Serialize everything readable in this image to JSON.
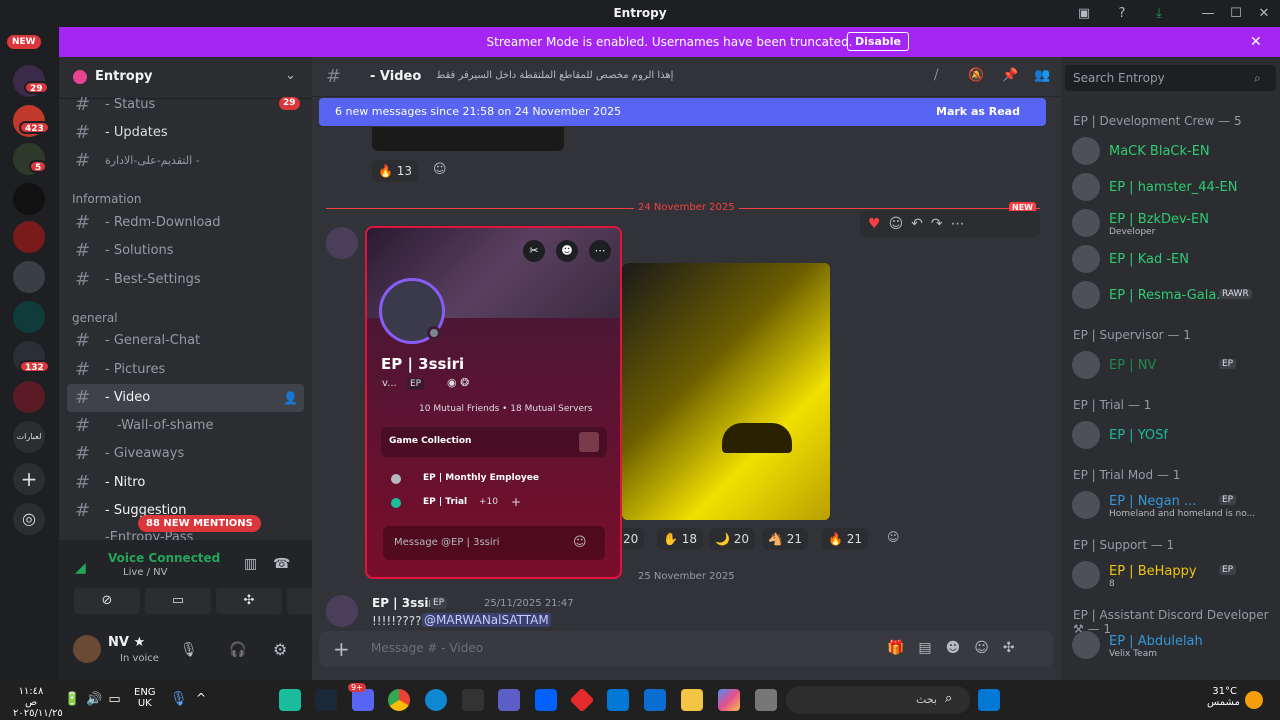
{
  "window": {
    "title": "Entropy"
  },
  "new_badge": "NEW",
  "banner": {
    "text": "Streamer Mode is enabled. Usernames have been truncated.",
    "button": "Disable"
  },
  "servers": [
    {
      "badge": "29"
    },
    {
      "badge": "423"
    },
    {
      "badge": "5"
    },
    {
      "badge": ""
    },
    {
      "badge": ""
    },
    {
      "badge": ""
    },
    {
      "badge": ""
    },
    {
      "badge": "132"
    },
    {
      "badge": ""
    },
    {
      "label": "لعبارات"
    }
  ],
  "guild": {
    "name": "Entropy"
  },
  "channels": {
    "top": [
      {
        "name": "- Status",
        "badge": "29"
      },
      {
        "name": "- Updates"
      },
      {
        "name": "التقديم-على-الادارة -"
      }
    ],
    "cat_info": "Information",
    "info": [
      {
        "name": "- Redm-Download"
      },
      {
        "name": "- Solutions"
      },
      {
        "name": "- Best-Settings"
      }
    ],
    "cat_general": "general",
    "general": [
      {
        "name": "- General-Chat"
      },
      {
        "name": "- Pictures"
      },
      {
        "name": "- Video"
      },
      {
        "name": "-Wall-of-shame"
      },
      {
        "name": "- Giveaways"
      },
      {
        "name": "- Nitro"
      },
      {
        "name": "- Suggestion"
      },
      {
        "name": "-Entropy-Pass"
      }
    ],
    "mentions": "88 NEW MENTIONS"
  },
  "voice": {
    "status": "Voice Connected",
    "channel": "Live / NV"
  },
  "user": {
    "name": "NV ★",
    "status": "In voice"
  },
  "header": {
    "channel": "- Video",
    "topic": "إهذا الروم مخصص للمقاطع الملتقطة داخل السيرفر فقط"
  },
  "newbar": {
    "text": "6 new messages since 21:58 on 24 November 2025",
    "mark": "Mark as Read"
  },
  "messages": {
    "top_reaction": "13",
    "divider1": "24 November 2025",
    "new_tag": "NEW",
    "reactions": [
      "20",
      "18",
      "20",
      "21",
      "21"
    ],
    "divider2": "25 November 2025",
    "msg2_author": "EP | 3ssiri",
    "msg2_tag": "EP",
    "msg2_time": "25/11/2025 21:47",
    "msg2_text": "!!!!!????",
    "msg2_mention": "@MARWANalSATTAM"
  },
  "input": {
    "placeholder": "Message # - Video"
  },
  "popout": {
    "name": "EP | 3ssiri",
    "tag_prefix": "v...",
    "tag": "EP",
    "mutuals": "10 Mutual Friends • 18 Mutual Servers",
    "game_collection": "Game Collection",
    "role1": "EP | Monthly Employee",
    "role2": "EP | Trial",
    "more": "+10",
    "message_placeholder": "Message @EP | 3ssiri"
  },
  "search": {
    "placeholder": "Search Entropy"
  },
  "members": {
    "groups": [
      {
        "title": "EP | Development Crew — 5",
        "items": [
          {
            "name": "MaCK BlaCk-EN",
            "color": "#2ecc71"
          },
          {
            "name": "EP | hamster_44-EN",
            "color": "#2ecc71"
          },
          {
            "name": "EP | BzkDev-EN",
            "color": "#2ecc71",
            "sub": "Developer"
          },
          {
            "name": "EP | Kad -EN",
            "color": "#2ecc71"
          },
          {
            "name": "EP | Resma-Gala...",
            "color": "#2ecc71",
            "extra": "RAWR"
          }
        ]
      },
      {
        "title": "EP | Supervisor — 1",
        "items": [
          {
            "name": "EP | NV",
            "color": "#1f8b4c",
            "extra": "EP"
          }
        ]
      },
      {
        "title": "EP | Trial — 1",
        "items": [
          {
            "name": "EP | YOSf",
            "color": "#1abc9c"
          }
        ]
      },
      {
        "title": "EP | Trial Mod — 1",
        "items": [
          {
            "name": "EP | Negan ...",
            "color": "#3498db",
            "extra": "EP",
            "sub": "Homeland and homeland is no..."
          }
        ]
      },
      {
        "title": "EP | Support — 1",
        "items": [
          {
            "name": "EP | BeHappy",
            "color": "#f1c40f",
            "extra": "EP",
            "sub": "8"
          }
        ]
      },
      {
        "title": "EP | Assistant Discord Developer ⚒ — 1",
        "items": [
          {
            "name": "EP | Abdulelah",
            "color": "#3498db",
            "sub": "Velix Team"
          }
        ]
      }
    ]
  },
  "taskbar": {
    "time": "١١:٤٨ ص",
    "date": "٢٠٢٥/١١/٢٥",
    "lang": "ENG",
    "region": "UK",
    "search": "بحث",
    "temp": "31°C",
    "weather": "مشمس",
    "discord_badge": "9+"
  }
}
